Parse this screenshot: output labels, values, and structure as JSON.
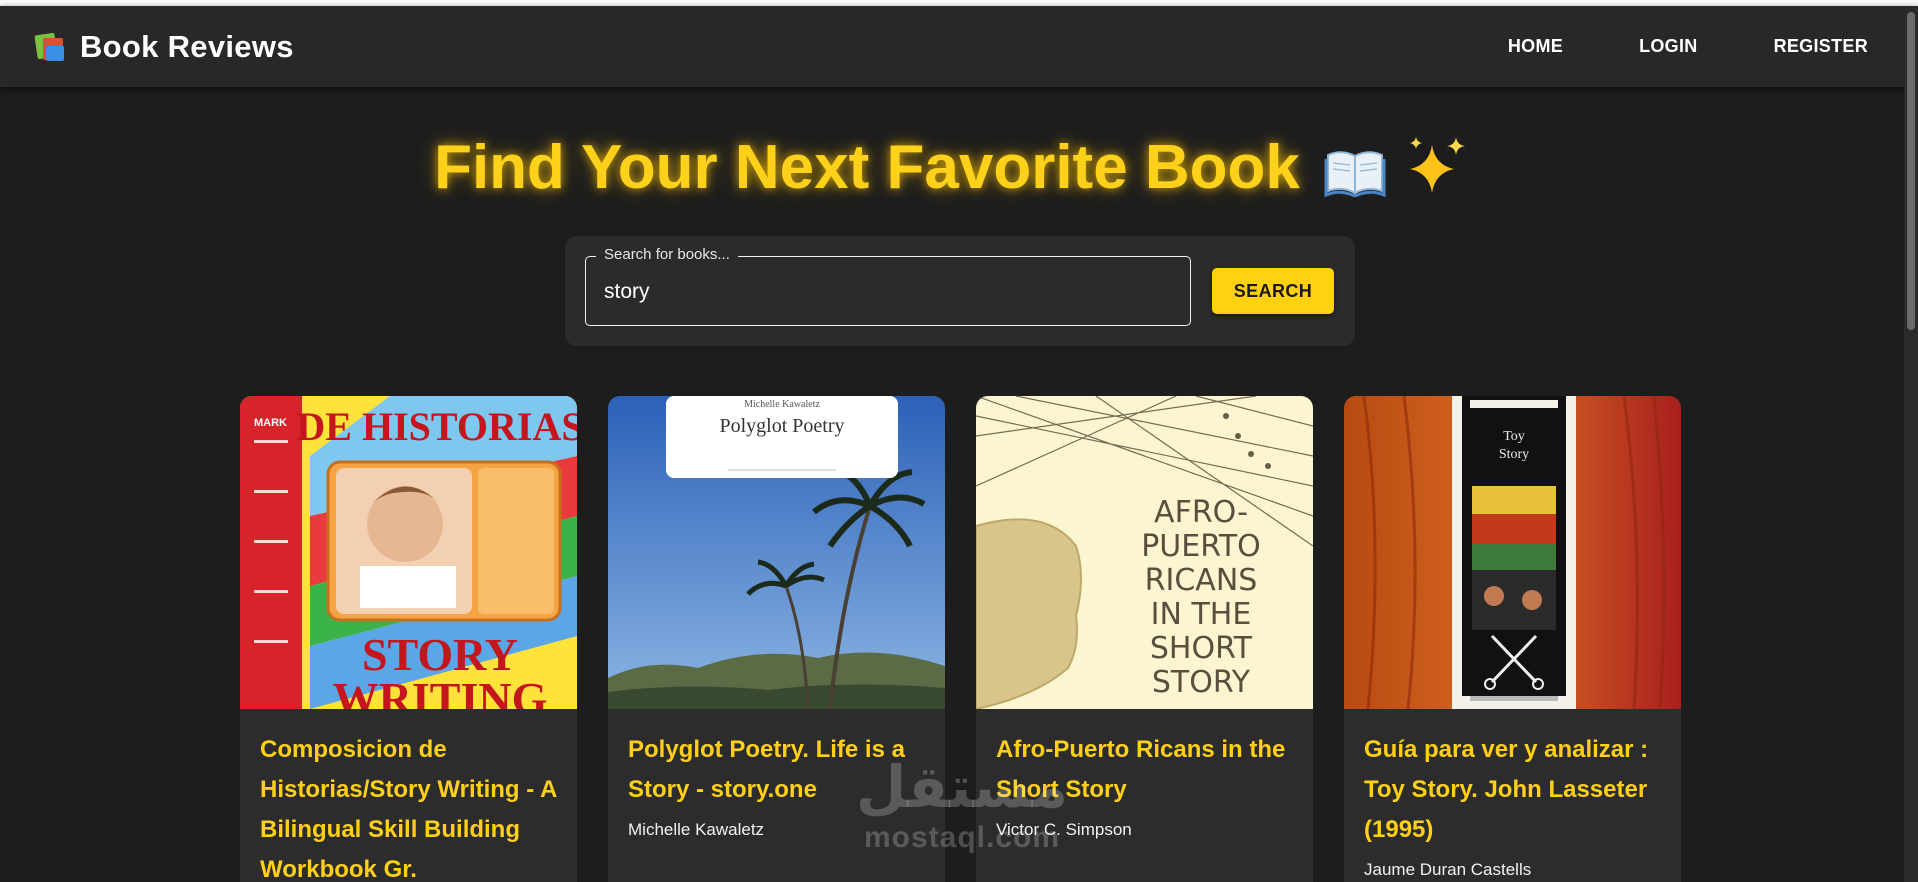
{
  "app": {
    "title": "Book Reviews",
    "logo_icon": "books-icon"
  },
  "nav": {
    "items": [
      {
        "label": "HOME"
      },
      {
        "label": "LOGIN"
      },
      {
        "label": "REGISTER"
      }
    ]
  },
  "hero": {
    "title": "Find Your Next Favorite Book",
    "icons": [
      "open-book-icon",
      "sparkles-icon"
    ]
  },
  "search": {
    "label": "Search for books...",
    "value": "story",
    "button_label": "SEARCH"
  },
  "books": [
    {
      "title": "Composicion de Historias/Story Writing - A Bilingual Skill Building Workbook Gr.",
      "cover_text": [
        "DE HISTORIAS",
        "STORY",
        "WRITING",
        "MARK"
      ]
    },
    {
      "title": "Polyglot Poetry. Life is a Story - story.one",
      "author": "Michelle Kawaletz",
      "cover_text": [
        "Michelle Kawaletz",
        "Polyglot Poetry"
      ]
    },
    {
      "title": "Afro-Puerto Ricans in the Short Story",
      "author": "Victor C. Simpson",
      "cover_text": [
        "AFRO-",
        "PUERTO",
        "RICANS",
        "IN THE",
        "SHORT",
        "STORY"
      ]
    },
    {
      "title": "Guía para ver y analizar : Toy Story. John Lasseter (1995)",
      "author": "Jaume Duran Castells",
      "cover_text": [
        "Toy",
        "Story"
      ]
    }
  ],
  "watermark": {
    "arabic": "مستقل",
    "latin": "mostaql.com"
  },
  "colors": {
    "background": "#1d1d1d",
    "appbar": "#282828",
    "accent": "#ffd11a",
    "card": "#2c2c2c"
  }
}
